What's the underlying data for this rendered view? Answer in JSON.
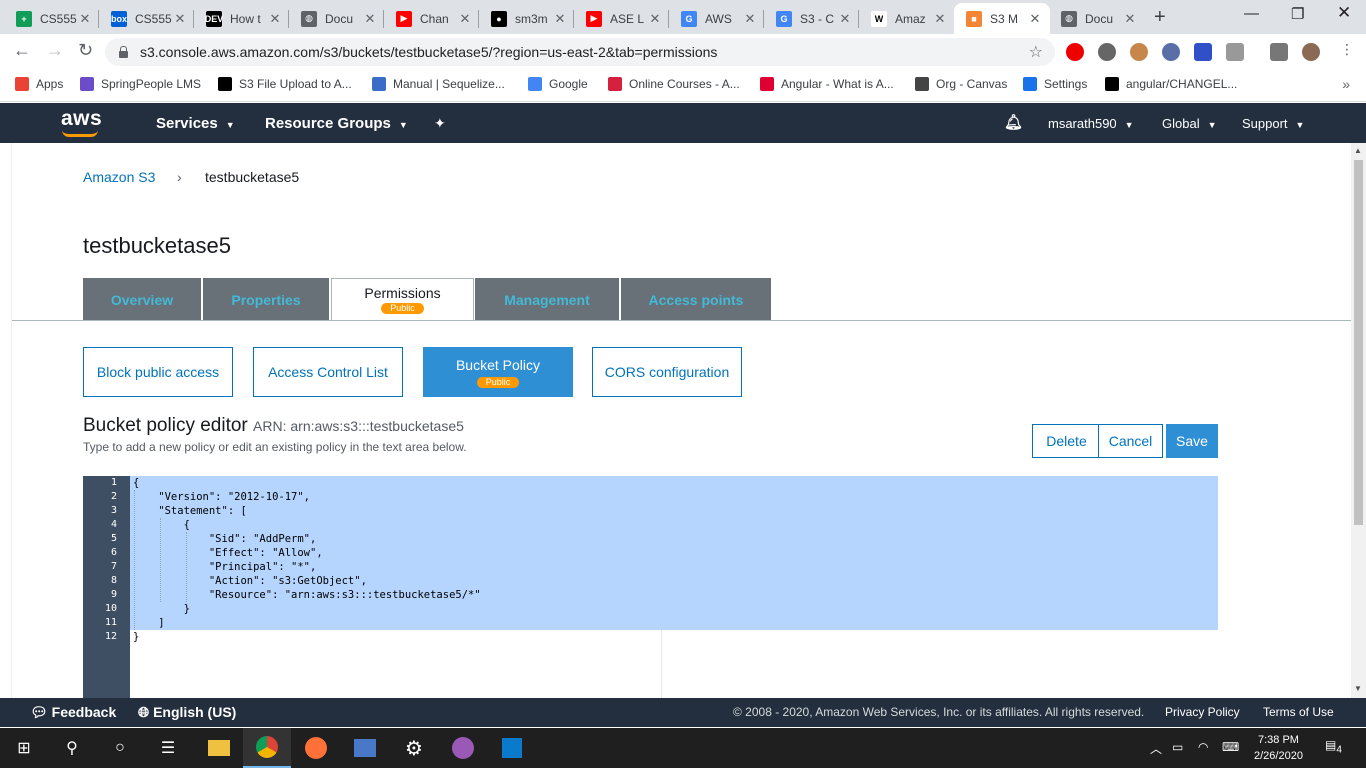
{
  "browser": {
    "tabs": [
      {
        "title": "CS555",
        "favicon_color": "#0f9d58",
        "favicon_glyph": "+"
      },
      {
        "title": "CS555",
        "favicon_color": "#0061d5",
        "favicon_glyph": "box"
      },
      {
        "title": "How t",
        "favicon_color": "#000000",
        "favicon_glyph": "DEV"
      },
      {
        "title": "Docu",
        "favicon_color": "#5f6368",
        "favicon_glyph": "◍"
      },
      {
        "title": "Chan",
        "favicon_color": "#ff0000",
        "favicon_glyph": "▶"
      },
      {
        "title": "sm3m",
        "favicon_color": "#000000",
        "favicon_glyph": "●"
      },
      {
        "title": "ASE L",
        "favicon_color": "#ff0000",
        "favicon_glyph": "▶"
      },
      {
        "title": "AWS",
        "favicon_color": "#4285f4",
        "favicon_glyph": "G"
      },
      {
        "title": "S3 - C",
        "favicon_color": "#4285f4",
        "favicon_glyph": "G"
      },
      {
        "title": "Amaz",
        "favicon_color": "#ffffff",
        "favicon_glyph": "W"
      },
      {
        "title": "S3 M",
        "favicon_color": "#f58536",
        "favicon_glyph": "■"
      },
      {
        "title": "Docu",
        "favicon_color": "#5f6368",
        "favicon_glyph": "◍"
      }
    ],
    "active_tab_index": 10,
    "url": "s3.console.aws.amazon.com/s3/buckets/testbucketase5/?region=us-east-2&tab=permissions",
    "bookmarks": [
      {
        "label": "Apps",
        "color": "#ea4335"
      },
      {
        "label": "SpringPeople LMS",
        "color": "#6c4cc8"
      },
      {
        "label": "S3 File Upload to A...",
        "color": "#000000"
      },
      {
        "label": "Manual | Sequelize...",
        "color": "#3b6cc8"
      },
      {
        "label": "Google",
        "color": "#4285f4"
      },
      {
        "label": "Online Courses - A...",
        "color": "#d4213d"
      },
      {
        "label": "Angular - What is A...",
        "color": "#dd0031"
      },
      {
        "label": "Org - Canvas",
        "color": "#444444"
      },
      {
        "label": "Settings",
        "color": "#1a73e8"
      },
      {
        "label": "angular/CHANGEL...",
        "color": "#000000"
      }
    ],
    "more_glyph": "»"
  },
  "aws_header": {
    "logo": "aws",
    "services": "Services",
    "resource_groups": "Resource Groups",
    "user": "msarath590",
    "region": "Global",
    "support": "Support"
  },
  "breadcrumb": {
    "root": "Amazon S3",
    "sep": "›",
    "current": "testbucketase5"
  },
  "bucket_name": "testbucketase5",
  "main_tabs": [
    {
      "label": "Overview"
    },
    {
      "label": "Properties"
    },
    {
      "label": "Permissions",
      "badge": "Public"
    },
    {
      "label": "Management"
    },
    {
      "label": "Access points"
    }
  ],
  "sub_tabs": [
    {
      "label": "Block public access"
    },
    {
      "label": "Access Control List"
    },
    {
      "label": "Bucket Policy",
      "badge": "Public"
    },
    {
      "label": "CORS configuration"
    }
  ],
  "editor": {
    "title": "Bucket policy editor",
    "arn_label": "ARN: arn:aws:s3:::testbucketase5",
    "help": "Type to add a new policy or edit an existing policy in the text area below.",
    "delete": "Delete",
    "cancel": "Cancel",
    "save": "Save",
    "lines": [
      "{",
      "    \"Version\": \"2012-10-17\",",
      "    \"Statement\": [",
      "        {",
      "            \"Sid\": \"AddPerm\",",
      "            \"Effect\": \"Allow\",",
      "            \"Principal\": \"*\",",
      "            \"Action\": \"s3:GetObject\",",
      "            \"Resource\": \"arn:aws:s3:::testbucketase5/*\"",
      "        }",
      "    ]",
      "}"
    ]
  },
  "footer": {
    "feedback": "Feedback",
    "language": "English (US)",
    "copyright": "© 2008 - 2020, Amazon Web Services, Inc. or its affiliates. All rights reserved.",
    "privacy": "Privacy Policy",
    "terms": "Terms of Use"
  },
  "taskbar": {
    "time": "7:38 PM",
    "date": "2/26/2020",
    "notifications": "4"
  }
}
